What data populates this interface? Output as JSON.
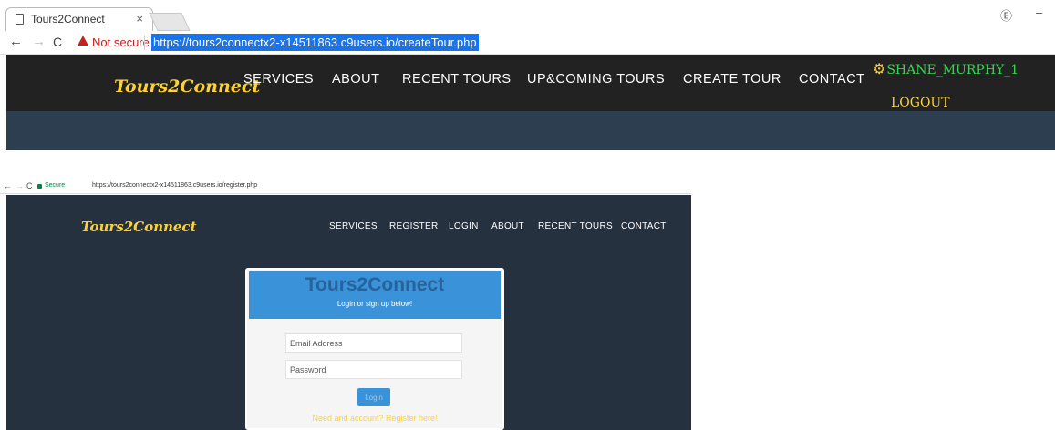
{
  "top_browser": {
    "tab_title": "Tours2Connect",
    "tab_close": "×",
    "security_label": "Not secure",
    "url": "https://tours2connectx2-x14511863.c9users.io/createTour.php"
  },
  "top_site": {
    "logo": "Tours2Connect",
    "nav": [
      "SERVICES",
      "ABOUT",
      "RECENT TOURS",
      "UP&COMING TOURS",
      "CREATE TOUR",
      "CONTACT"
    ],
    "username": "SHANE_MURPHY_1",
    "logout": "LOGOUT",
    "colors": {
      "navbar": "#222222",
      "header": "#2c3e50",
      "accent": "#fed136",
      "username": "#39d353"
    }
  },
  "bottom_browser": {
    "security_label": "Secure",
    "url": "https://tours2connectx2-x14511863.c9users.io/register.php"
  },
  "bottom_site": {
    "logo": "Tours2Connect",
    "nav": [
      "SERVICES",
      "REGISTER",
      "LOGIN",
      "ABOUT",
      "RECENT TOURS",
      "CONTACT"
    ],
    "login_card": {
      "title": "Tours2Connect",
      "subtitle": "Login or sign up below!",
      "email_placeholder": "Email Address",
      "password_placeholder": "Password",
      "login_button": "Login",
      "register_link": "Need and account? Register here!"
    },
    "colors": {
      "background": "#25313f",
      "card_header": "#3a92d8",
      "accent": "#fed136"
    }
  }
}
